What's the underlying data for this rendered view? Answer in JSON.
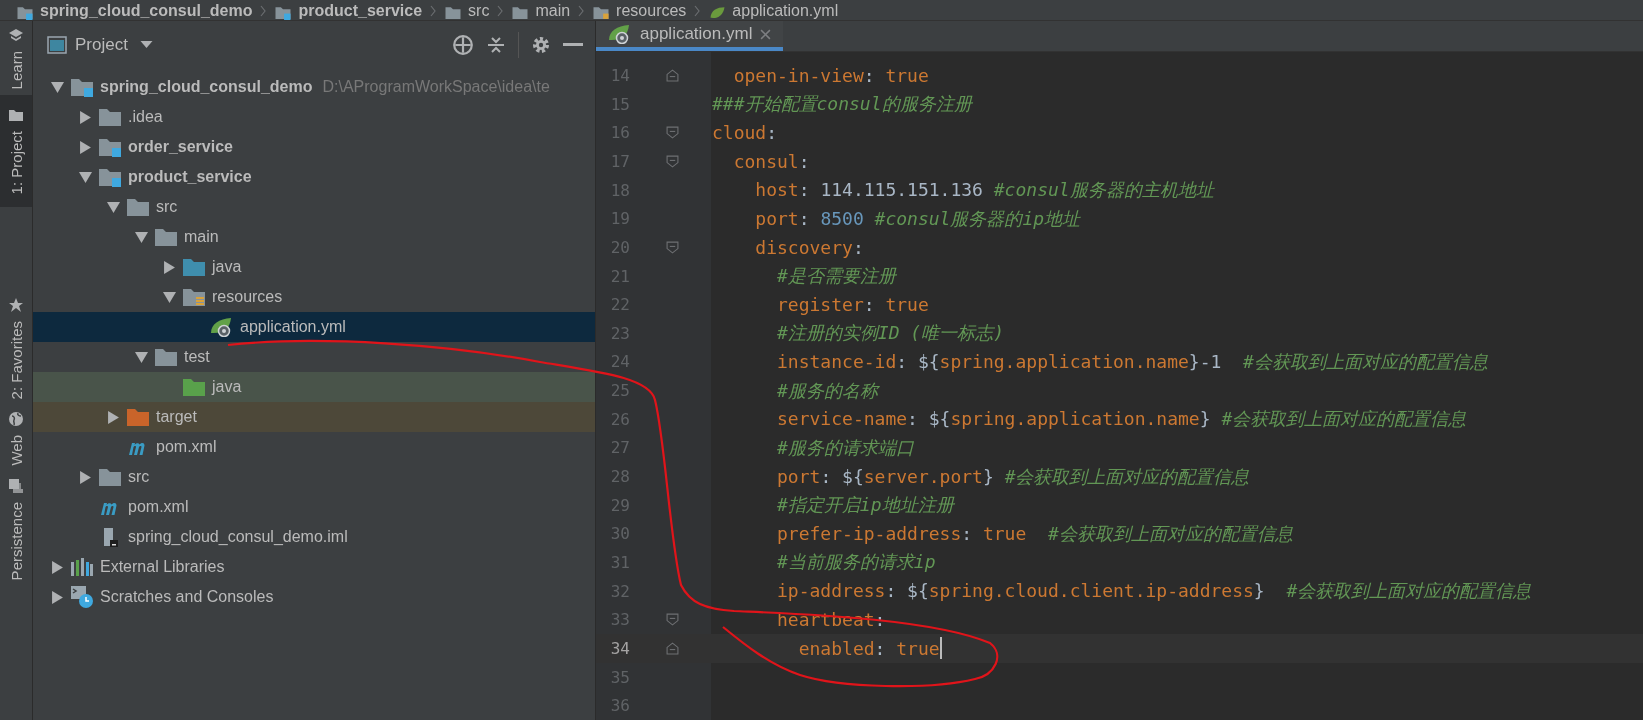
{
  "breadcrumb": [
    {
      "label": "spring_cloud_consul_demo",
      "kind": "module"
    },
    {
      "label": "product_service",
      "kind": "module"
    },
    {
      "label": "src",
      "kind": "folder"
    },
    {
      "label": "main",
      "kind": "folder"
    },
    {
      "label": "resources",
      "kind": "resources-folder"
    },
    {
      "label": "application.yml",
      "kind": "yaml-file"
    }
  ],
  "tool_strip": [
    {
      "label": "Learn",
      "kind": "learn",
      "selected": false
    },
    {
      "label": "1: Project",
      "kind": "project",
      "selected": true
    },
    {
      "label": "2: Favorites",
      "kind": "favorites",
      "selected": false
    },
    {
      "label": "Web",
      "kind": "web",
      "selected": false
    },
    {
      "label": "Persistence",
      "kind": "persistence",
      "selected": false
    }
  ],
  "project_panel": {
    "title": "Project",
    "tree": [
      {
        "label": "spring_cloud_consul_demo",
        "kind": "module",
        "path": "D:\\AProgramWorkSpace\\idea\\te",
        "expanded": true,
        "selected": false,
        "children": [
          {
            "label": ".idea",
            "kind": "folder",
            "expanded": false,
            "selected": false
          },
          {
            "label": "order_service",
            "kind": "module",
            "expanded": false,
            "selected": false
          },
          {
            "label": "product_service",
            "kind": "module",
            "expanded": true,
            "selected": false,
            "children": [
              {
                "label": "src",
                "kind": "folder",
                "expanded": true,
                "selected": false,
                "children": [
                  {
                    "label": "main",
                    "kind": "folder",
                    "expanded": true,
                    "selected": false,
                    "children": [
                      {
                        "label": "java",
                        "kind": "source-folder",
                        "expanded": false,
                        "selected": false
                      },
                      {
                        "label": "resources",
                        "kind": "resources-folder",
                        "expanded": true,
                        "selected": false,
                        "children": [
                          {
                            "label": "application.yml",
                            "kind": "yaml-file",
                            "selected": true
                          }
                        ]
                      }
                    ]
                  },
                  {
                    "label": "test",
                    "kind": "folder",
                    "expanded": true,
                    "selected": false,
                    "children": [
                      {
                        "label": "java",
                        "kind": "test-folder",
                        "selected": false
                      }
                    ]
                  }
                ]
              },
              {
                "label": "target",
                "kind": "excluded-folder",
                "expanded": false,
                "selected": false
              },
              {
                "label": "pom.xml",
                "kind": "maven-file",
                "selected": false
              }
            ]
          },
          {
            "label": "src",
            "kind": "folder",
            "expanded": false,
            "selected": false
          },
          {
            "label": "pom.xml",
            "kind": "maven-file",
            "selected": false
          },
          {
            "label": "spring_cloud_consul_demo.iml",
            "kind": "iml-file",
            "selected": false
          }
        ]
      },
      {
        "label": "External Libraries",
        "kind": "libraries",
        "expanded": false,
        "selected": false
      },
      {
        "label": "Scratches and Consoles",
        "kind": "scratches",
        "expanded": false,
        "selected": false
      }
    ]
  },
  "editor": {
    "tabs": [
      {
        "label": "application.yml",
        "selected": true
      }
    ],
    "lines": [
      {
        "number": "14",
        "kind": "fold-end",
        "current": false,
        "segments": [
          {
            "kind": "key",
            "text": "  open-in-view"
          },
          {
            "kind": "plain",
            "text": ": "
          },
          {
            "kind": "keyword",
            "text": "true"
          }
        ]
      },
      {
        "number": "15",
        "kind": "plain",
        "current": false,
        "segments": [
          {
            "kind": "comment",
            "text": "###开始配置consul的服务注册"
          }
        ]
      },
      {
        "number": "16",
        "kind": "fold-start",
        "current": false,
        "segments": [
          {
            "kind": "key",
            "text": "cloud"
          },
          {
            "kind": "plain",
            "text": ":"
          }
        ]
      },
      {
        "number": "17",
        "kind": "fold-start",
        "current": false,
        "segments": [
          {
            "kind": "key",
            "text": "  consul"
          },
          {
            "kind": "plain",
            "text": ":"
          }
        ]
      },
      {
        "number": "18",
        "kind": "plain",
        "current": false,
        "segments": [
          {
            "kind": "key",
            "text": "    host"
          },
          {
            "kind": "plain",
            "text": ": 114.115.151.136 "
          },
          {
            "kind": "comment",
            "text": "#consul服务器的主机地址"
          }
        ]
      },
      {
        "number": "19",
        "kind": "plain",
        "current": false,
        "segments": [
          {
            "kind": "key",
            "text": "    port"
          },
          {
            "kind": "plain",
            "text": ": "
          },
          {
            "kind": "number",
            "text": "8500"
          },
          {
            "kind": "comment",
            "text": " #consul服务器的ip地址"
          }
        ]
      },
      {
        "number": "20",
        "kind": "fold-start",
        "current": false,
        "segments": [
          {
            "kind": "key",
            "text": "    discovery"
          },
          {
            "kind": "plain",
            "text": ":"
          }
        ]
      },
      {
        "number": "21",
        "kind": "plain",
        "current": false,
        "segments": [
          {
            "kind": "comment",
            "text": "      #是否需要注册"
          }
        ]
      },
      {
        "number": "22",
        "kind": "plain",
        "current": false,
        "segments": [
          {
            "kind": "key",
            "text": "      register"
          },
          {
            "kind": "plain",
            "text": ": "
          },
          {
            "kind": "keyword",
            "text": "true"
          }
        ]
      },
      {
        "number": "23",
        "kind": "plain",
        "current": false,
        "segments": [
          {
            "kind": "comment",
            "text": "      #注册的实例ID (唯一标志)"
          }
        ]
      },
      {
        "number": "24",
        "kind": "plain",
        "current": false,
        "segments": [
          {
            "kind": "key",
            "text": "      instance-id"
          },
          {
            "kind": "plain",
            "text": ": ${"
          },
          {
            "kind": "keyword",
            "text": "spring.application.name"
          },
          {
            "kind": "plain",
            "text": "}-1  "
          },
          {
            "kind": "comment",
            "text": "#会获取到上面对应的配置信息"
          }
        ]
      },
      {
        "number": "25",
        "kind": "plain",
        "current": false,
        "segments": [
          {
            "kind": "comment",
            "text": "      #服务的名称"
          }
        ]
      },
      {
        "number": "26",
        "kind": "plain",
        "current": false,
        "segments": [
          {
            "kind": "key",
            "text": "      service-name"
          },
          {
            "kind": "plain",
            "text": ": ${"
          },
          {
            "kind": "keyword",
            "text": "spring.application.name"
          },
          {
            "kind": "plain",
            "text": "} "
          },
          {
            "kind": "comment",
            "text": "#会获取到上面对应的配置信息"
          }
        ]
      },
      {
        "number": "27",
        "kind": "plain",
        "current": false,
        "segments": [
          {
            "kind": "comment",
            "text": "      #服务的请求端口"
          }
        ]
      },
      {
        "number": "28",
        "kind": "plain",
        "current": false,
        "segments": [
          {
            "kind": "key",
            "text": "      port"
          },
          {
            "kind": "plain",
            "text": ": ${"
          },
          {
            "kind": "keyword",
            "text": "server.port"
          },
          {
            "kind": "plain",
            "text": "} "
          },
          {
            "kind": "comment",
            "text": "#会获取到上面对应的配置信息"
          }
        ]
      },
      {
        "number": "29",
        "kind": "plain",
        "current": false,
        "segments": [
          {
            "kind": "comment",
            "text": "      #指定开启ip地址注册"
          }
        ]
      },
      {
        "number": "30",
        "kind": "plain",
        "current": false,
        "segments": [
          {
            "kind": "key",
            "text": "      prefer-ip-address"
          },
          {
            "kind": "plain",
            "text": ": "
          },
          {
            "kind": "keyword",
            "text": "true"
          },
          {
            "kind": "comment",
            "text": "  #会获取到上面对应的配置信息"
          }
        ]
      },
      {
        "number": "31",
        "kind": "plain",
        "current": false,
        "segments": [
          {
            "kind": "comment",
            "text": "      #当前服务的请求ip"
          }
        ]
      },
      {
        "number": "32",
        "kind": "plain",
        "current": false,
        "segments": [
          {
            "kind": "key",
            "text": "      ip-address"
          },
          {
            "kind": "plain",
            "text": ": ${"
          },
          {
            "kind": "keyword",
            "text": "spring.cloud.client.ip-address"
          },
          {
            "kind": "plain",
            "text": "}  "
          },
          {
            "kind": "comment",
            "text": "#会获取到上面对应的配置信息"
          }
        ]
      },
      {
        "number": "33",
        "kind": "fold-start",
        "current": false,
        "segments": [
          {
            "kind": "key",
            "text": "      heartbeat"
          },
          {
            "kind": "plain",
            "text": ":"
          }
        ]
      },
      {
        "number": "34",
        "kind": "fold-end",
        "current": true,
        "segments": [
          {
            "kind": "key",
            "text": "        enabled"
          },
          {
            "kind": "plain",
            "text": ": "
          },
          {
            "kind": "keyword",
            "text": "true"
          }
        ]
      },
      {
        "number": "35",
        "kind": "plain",
        "current": false
      },
      {
        "number": "36",
        "kind": "plain",
        "current": false
      }
    ]
  }
}
